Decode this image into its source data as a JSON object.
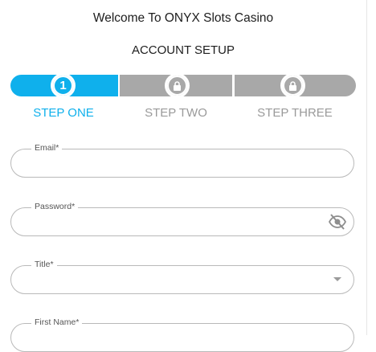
{
  "header": {
    "title": "Welcome To ONYX Slots Casino",
    "subtitle": "ACCOUNT SETUP"
  },
  "stepper": {
    "steps": [
      {
        "number": "1",
        "label": "STEP ONE",
        "state": "active"
      },
      {
        "label": "STEP TWO",
        "state": "locked",
        "icon": "lock-icon"
      },
      {
        "label": "STEP THREE",
        "state": "locked",
        "icon": "lock-icon"
      }
    ],
    "colors": {
      "active": "#0fb0ec",
      "inactive": "#a8a8a8"
    }
  },
  "form": {
    "email": {
      "label": "Email*",
      "value": ""
    },
    "password": {
      "label": "Password*",
      "value": "",
      "toggle_icon": "eye-slash-icon"
    },
    "title": {
      "label": "Title*",
      "value": "",
      "icon": "chevron-down-icon"
    },
    "first_name": {
      "label": "First Name*",
      "value": ""
    }
  }
}
